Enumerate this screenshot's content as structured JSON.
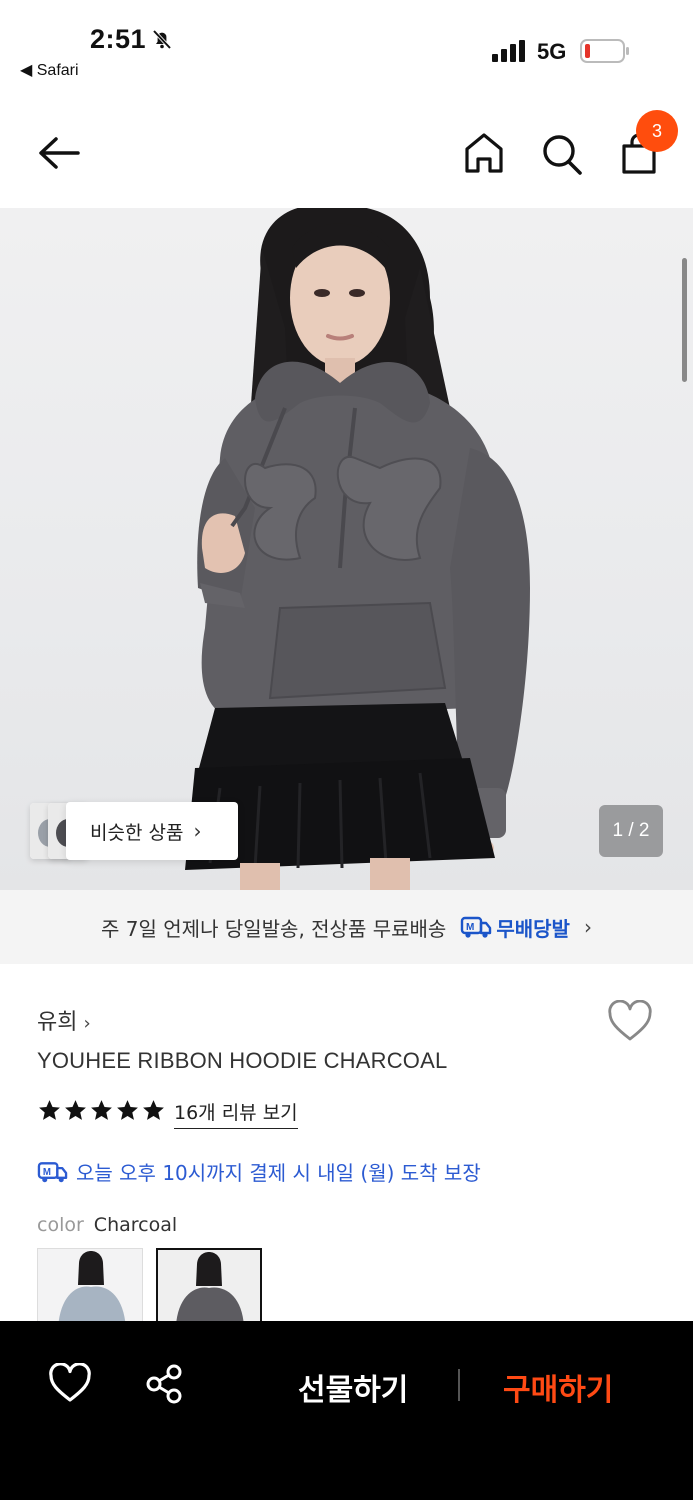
{
  "status_bar": {
    "time": "2:51",
    "back_app": "◀ Safari",
    "network": "5G"
  },
  "nav": {
    "cart_count": "3"
  },
  "hero": {
    "similar_label": "비슷한 상품",
    "page_indicator": "1 / 2"
  },
  "delivery_banner": {
    "text": "주 7일 언제나 당일발송, 전상품 무료배송",
    "brand": "무배당발"
  },
  "product": {
    "brand": "유희",
    "title": "YOUHEE RIBBON HOODIE CHARCOAL",
    "rating_stars": 5,
    "review_link": "16개 리뷰 보기",
    "arrival": "오늘 오후 10시까지 결제 시 내일 (월) 도착 보장",
    "color_label": "color",
    "color_value": "Charcoal"
  },
  "bottom_bar": {
    "gift": "선물하기",
    "buy": "구매하기"
  },
  "colors": {
    "accent": "#ff4a14",
    "badge": "#ff4d0d",
    "delivery_blue": "#1b55c9"
  }
}
